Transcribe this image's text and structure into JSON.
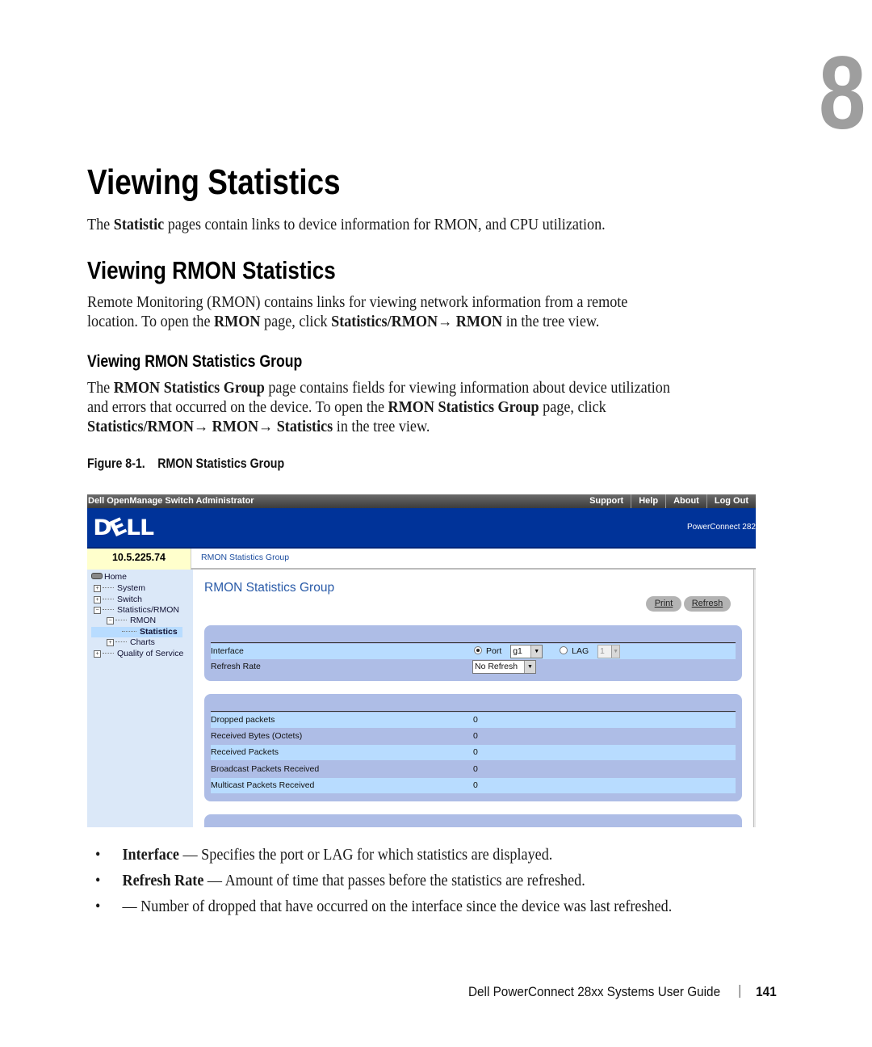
{
  "chapter_number": "8",
  "heading1": "Viewing Statistics",
  "intro": {
    "pre": "The ",
    "bold": "Statistic",
    "post": " pages contain links to device information for RMON, and CPU utilization."
  },
  "heading2": "Viewing RMON Statistics",
  "rmon_para": {
    "line1": "Remote Monitoring (RMON) contains links for viewing network information from a remote",
    "line2_pre": "location. To open the ",
    "line2_b1": "RMON",
    "line2_mid": " page, click ",
    "line2_b2": "Statistics/RMON→ RMON",
    "line2_post": " in the tree view."
  },
  "heading3": "Viewing RMON Statistics Group",
  "group_para": {
    "l1_pre": "The ",
    "l1_b": "RMON Statistics Group",
    "l1_post": " page contains fields for viewing information about device utilization",
    "l2_pre": "and errors that occurred on the device. To open the ",
    "l2_b": "RMON Statistics Group",
    "l2_post": " page, click",
    "l3_b": "Statistics/RMON→ RMON→ Statistics",
    "l3_post": " in the tree view."
  },
  "figure_caption": {
    "number": "Figure 8-1.",
    "title": "RMON Statistics Group"
  },
  "screenshot": {
    "app_title": "Dell OpenManage Switch Administrator",
    "top_links": [
      "Support",
      "Help",
      "About",
      "Log Out"
    ],
    "logo": "DELL",
    "product": "PowerConnect 282",
    "ip_address": "10.5.225.74",
    "breadcrumb": "RMON Statistics Group",
    "tree": {
      "home": "Home",
      "items": [
        "System",
        "Switch",
        "Statistics/RMON",
        "RMON",
        "Statistics",
        "Charts",
        "Quality of Service"
      ]
    },
    "page_title": "RMON Statistics Group",
    "print_label": "Print",
    "refresh_label": "Refresh",
    "interface_label": "Interface",
    "port_label": "Port",
    "port_value": "g1",
    "lag_label": "LAG",
    "lag_value": "1",
    "refresh_rate_label": "Refresh Rate",
    "refresh_rate_value": "No Refresh",
    "stats": [
      {
        "label": "Dropped packets",
        "value": "0"
      },
      {
        "label": "Received Bytes (Octets)",
        "value": "0"
      },
      {
        "label": "Received Packets",
        "value": "0"
      },
      {
        "label": "Broadcast Packets Received",
        "value": "0"
      },
      {
        "label": "Multicast Packets Received",
        "value": "0"
      }
    ]
  },
  "bullets": [
    {
      "term": "Interface",
      "desc": " — Specifies the port or LAG for which statistics are displayed."
    },
    {
      "term": "Refresh Rate",
      "desc": " — Amount of time that passes before the statistics are refreshed."
    },
    {
      "term": "",
      "desc": "— Number of dropped that have occurred on the interface since the device was last refreshed."
    }
  ],
  "footer": {
    "guide_title": "Dell PowerConnect 28xx Systems User Guide",
    "page_number": "141"
  }
}
